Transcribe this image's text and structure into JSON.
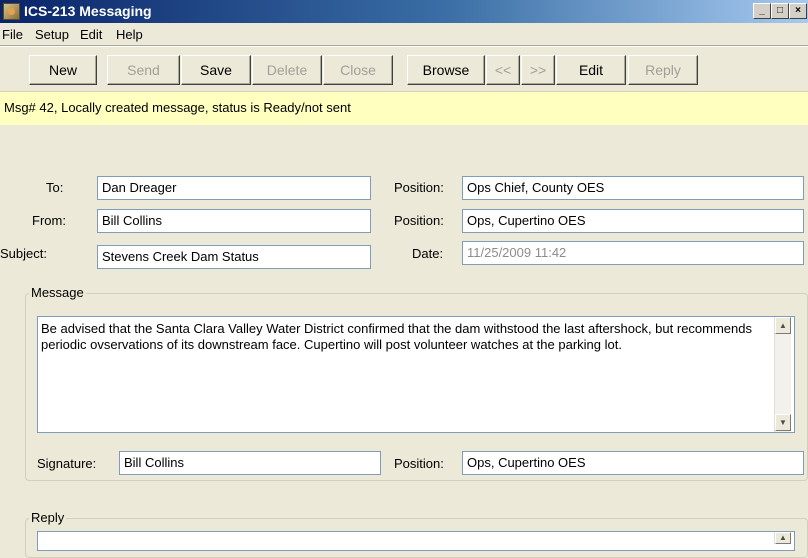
{
  "window": {
    "title": "ICS-213 Messaging",
    "controls": [
      "_",
      "□",
      "×"
    ]
  },
  "menu": [
    "File",
    "Setup",
    "Edit",
    "Help"
  ],
  "toolbar": {
    "new": "New",
    "send": "Send",
    "save": "Save",
    "delete": "Delete",
    "close": "Close",
    "browse": "Browse",
    "prev": "<<",
    "next": ">>",
    "edit": "Edit",
    "reply": "Reply"
  },
  "status_text": "Msg# 42,  Locally created message, status is Ready/not sent",
  "form": {
    "to_label": "To:",
    "to_value": "Dan Dreager",
    "to_position_label": "Position:",
    "to_position_value": "Ops Chief, County OES",
    "from_label": "From:",
    "from_value": "Bill Collins",
    "from_position_label": "Position:",
    "from_position_value": "Ops, Cupertino OES",
    "subject_label": "Subject:",
    "subject_value": "Stevens Creek Dam Status",
    "date_label": "Date:",
    "date_value": "11/25/2009 11:42"
  },
  "message": {
    "group_title": "Message",
    "body": "Be advised that the Santa Clara Valley Water District confirmed that the dam withstood the last aftershock, but recommends periodic ovservations of its downstream face.  Cupertino will post volunteer watches at the parking lot.",
    "signature_label": "Signature:",
    "signature_value": "Bill Collins",
    "position_label": "Position:",
    "position_value": "Ops, Cupertino OES"
  },
  "reply": {
    "group_title": "Reply"
  }
}
